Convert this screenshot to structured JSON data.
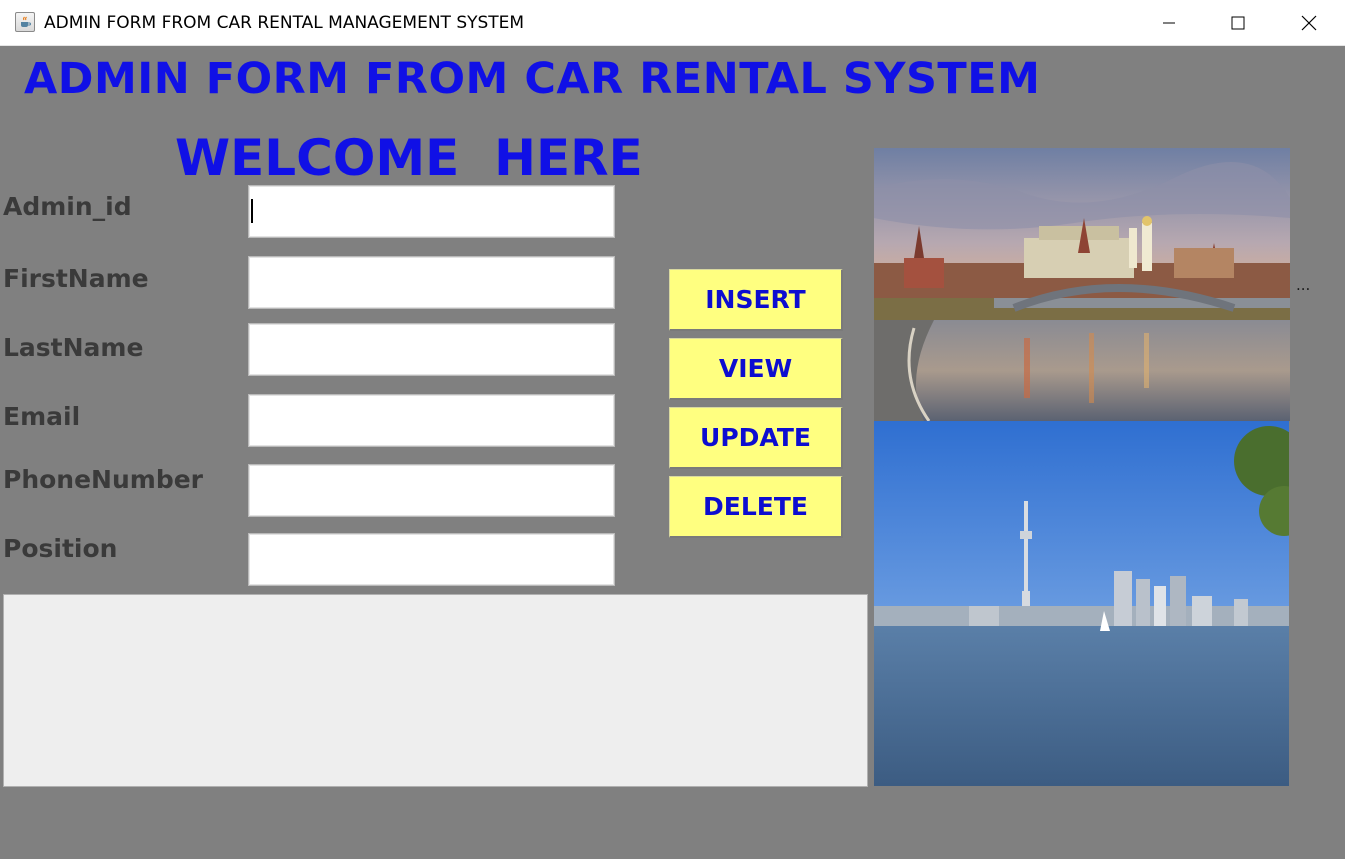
{
  "window": {
    "title": "ADMIN FORM FROM CAR RENTAL MANAGEMENT SYSTEM",
    "controls": [
      "minimize",
      "maximize",
      "close"
    ]
  },
  "header": {
    "title": "ADMIN FORM FROM CAR RENTAL SYSTEM",
    "welcome": "WELCOME  HERE"
  },
  "form": {
    "fields": [
      {
        "label": "Admin_id",
        "value": ""
      },
      {
        "label": "FirstName",
        "value": ""
      },
      {
        "label": "LastName",
        "value": ""
      },
      {
        "label": "Email",
        "value": ""
      },
      {
        "label": "PhoneNumber",
        "value": ""
      },
      {
        "label": "Position",
        "value": ""
      }
    ]
  },
  "actions": {
    "insert": "INSERT",
    "view": "VIEW",
    "update": "UPDATE",
    "delete": "DELETE"
  },
  "output": {
    "text": ""
  },
  "overflow_label": "...",
  "colors": {
    "background": "#808080",
    "title": "#1010e6",
    "button_bg": "#ffff80",
    "button_text": "#0d0dd0",
    "label_text": "#3a3a3a"
  },
  "images": [
    "kremlin-river-photo",
    "toronto-skyline-photo"
  ]
}
